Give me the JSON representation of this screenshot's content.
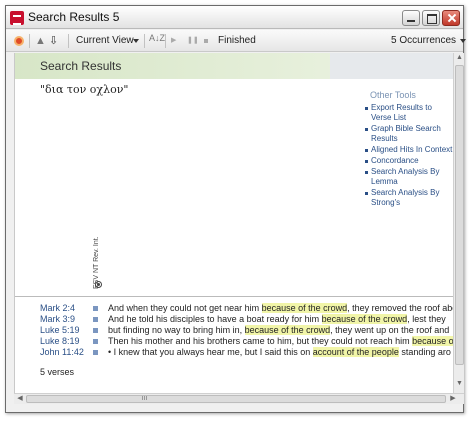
{
  "window": {
    "title": "Search Results 5"
  },
  "toolbar": {
    "up_icon": "▲",
    "down_icon": "⇩",
    "view_label": "Current View",
    "sort_icon": "A↓Z",
    "play_icon": "▶",
    "pause_icon": "❚❚",
    "status": "Finished",
    "occurrences_label": "5 Occurrences"
  },
  "panel": {
    "title": "Search Results",
    "query": "\"δια τον οχλον\"",
    "version_label": "ESV NT Rev. Int.",
    "other_tools": {
      "title": "Other Tools",
      "items": [
        "Export Results to Verse List",
        "Graph Bible Search Results",
        "Aligned Hits In Context",
        "Concordance",
        "Search Analysis By Lemma",
        "Search Analysis By Strong's"
      ]
    }
  },
  "results": {
    "rows": [
      {
        "ref": "Mark 2:4",
        "before": "And when they could not get near him ",
        "hit": "because of the crowd",
        "after": ", they removed the roof abo"
      },
      {
        "ref": "Mark 3:9",
        "before": "And he told his disciples to have a boat ready for him ",
        "hit": "because of the crowd",
        "after": ", lest they"
      },
      {
        "ref": "Luke 5:19",
        "before": "but finding no way to bring him in, ",
        "hit": "because of the crowd",
        "after": ", they went up on the roof and"
      },
      {
        "ref": "Luke 8:19",
        "before": "Then his mother and his brothers came to him, but they could not reach him ",
        "hit": "because o",
        "after": ""
      },
      {
        "ref": "John 11:42",
        "before": "• I knew that you always hear me, but I said this on ",
        "hit": "account of the people",
        "after": " standing aro"
      }
    ],
    "count_label": "5 verses"
  },
  "scrollbars": {
    "up_arrow": "▲",
    "down_arrow": "▼",
    "left_arrow": "◀",
    "right_arrow": "▶"
  }
}
